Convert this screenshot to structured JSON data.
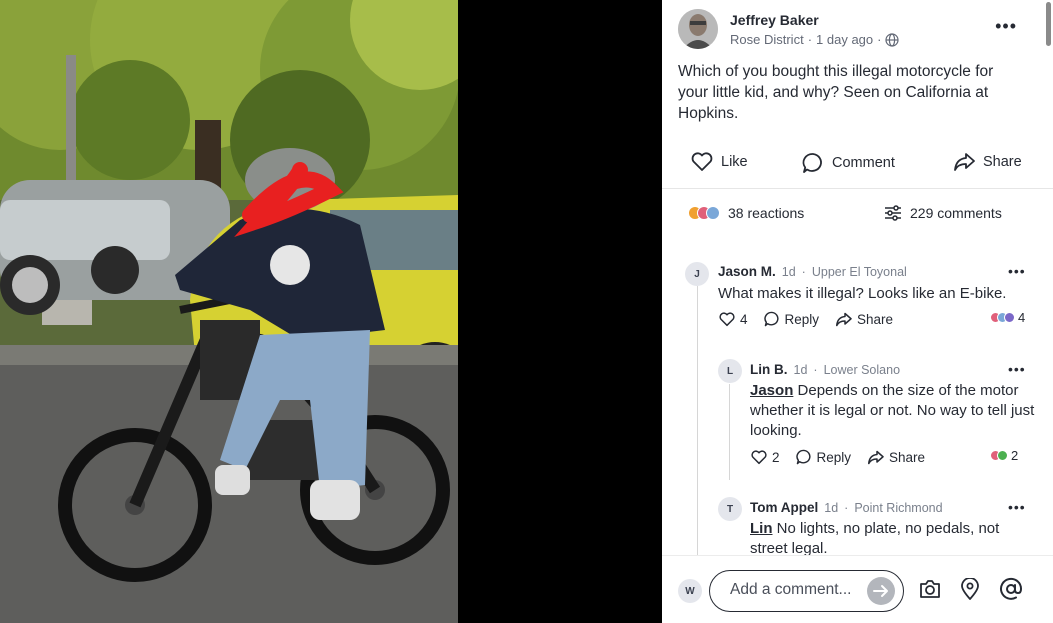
{
  "post": {
    "author": "Jeffrey Baker",
    "neighborhood": "Rose District",
    "sep1": "·",
    "time": "1 day ago",
    "sep2": "·",
    "text": "Which of you bought this illegal motorcycle for your little kid, and why? Seen on California at Hopkins."
  },
  "actions": {
    "like": "Like",
    "comment": "Comment",
    "share": "Share"
  },
  "stats": {
    "reactions": "38 reactions",
    "comments": "229 comments"
  },
  "comments": [
    {
      "initial": "J",
      "name": "Jason M.",
      "time": "1d",
      "sep": "·",
      "neighborhood": "Upper El Toyonal",
      "mention": "",
      "text": "What makes it illegal? Looks like an E-bike.",
      "likes": "4",
      "reply": "Reply",
      "share": "Share",
      "reaction_count": "4"
    },
    {
      "initial": "L",
      "name": "Lin B.",
      "time": "1d",
      "sep": "·",
      "neighborhood": "Lower Solano",
      "mention": "Jason",
      "text": " Depends on the size of the motor whether it is legal or not. No way to tell just looking.",
      "likes": "2",
      "reply": "Reply",
      "share": "Share",
      "reaction_count": "2"
    },
    {
      "initial": "T",
      "name": "Tom Appel",
      "time": "1d",
      "sep": "·",
      "neighborhood": "Point Richmond",
      "mention": "Lin",
      "text": " No lights, no plate, no pedals, not street legal."
    }
  ],
  "composer": {
    "initial": "W",
    "placeholder": "Add a comment..."
  },
  "colors": {
    "reaction_1": "#f0a030",
    "reaction_2": "#e0607a",
    "reaction_3": "#7aa7d8",
    "reaction_green": "#4cb050",
    "reaction_purple": "#7b68c8"
  }
}
